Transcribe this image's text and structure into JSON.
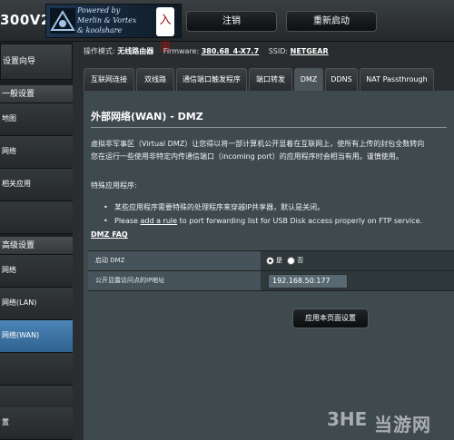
{
  "header": {
    "model": "300V2",
    "logo_line1": "Powered by",
    "logo_line2": "Merlin & Vortex",
    "logo_line3": "& koolshare",
    "seal": "入道",
    "logout_label": "注销",
    "reboot_label": "重新启动"
  },
  "infobar": {
    "mode_label": "操作模式:",
    "mode_value": "无线路由器",
    "firmware_label": "Firmware:",
    "firmware_value": "380.68_4-X7.7",
    "ssid_label": "SSID:",
    "ssid_value": "NETGEAR"
  },
  "sidebar": {
    "qis": "设置向导",
    "general_header": "一般设置",
    "items_general": [
      "地图",
      "网络",
      "相关应用",
      ""
    ],
    "advanced_header": "高级设置",
    "items_advanced": [
      "网络",
      "网络(LAN)",
      "网络(WAN)",
      "",
      "",
      "",
      "置"
    ]
  },
  "tabs": [
    "互联网连接",
    "双线路",
    "通信端口触发程序",
    "端口转发",
    "DMZ",
    "DDNS",
    "NAT Passthrough"
  ],
  "main": {
    "title": "外部网络(WAN) - DMZ",
    "desc_line1": "虚拟非军事区（Virtual DMZ）让您得以将一部计算机公开显着在互联网上，使所有上传的封包全数转向",
    "desc_line2": "您在运行一些使用非特定内传通信端口（incoming port）的应用程序时会相当有用。谨慎使用。",
    "special_label": "特殊应用程序:",
    "bullet1": "某些应用程序需要特殊的处理程序来穿越IP共享器，默认是关闭。",
    "bullet2_pre": "Please ",
    "bullet2_link": "add a rule",
    "bullet2_post": " to port forwarding list for USB Disk access properly on FTP service.",
    "faq": "DMZ FAQ",
    "enable_label": "启动 DMZ",
    "yes_label": "是",
    "no_label": "否",
    "ip_label": "公开显露访问点的IP地址",
    "ip_value": "192.168.50.177",
    "apply_label": "应用本页面设置"
  },
  "watermark": {
    "mark": "3HE",
    "text": "当游网"
  }
}
